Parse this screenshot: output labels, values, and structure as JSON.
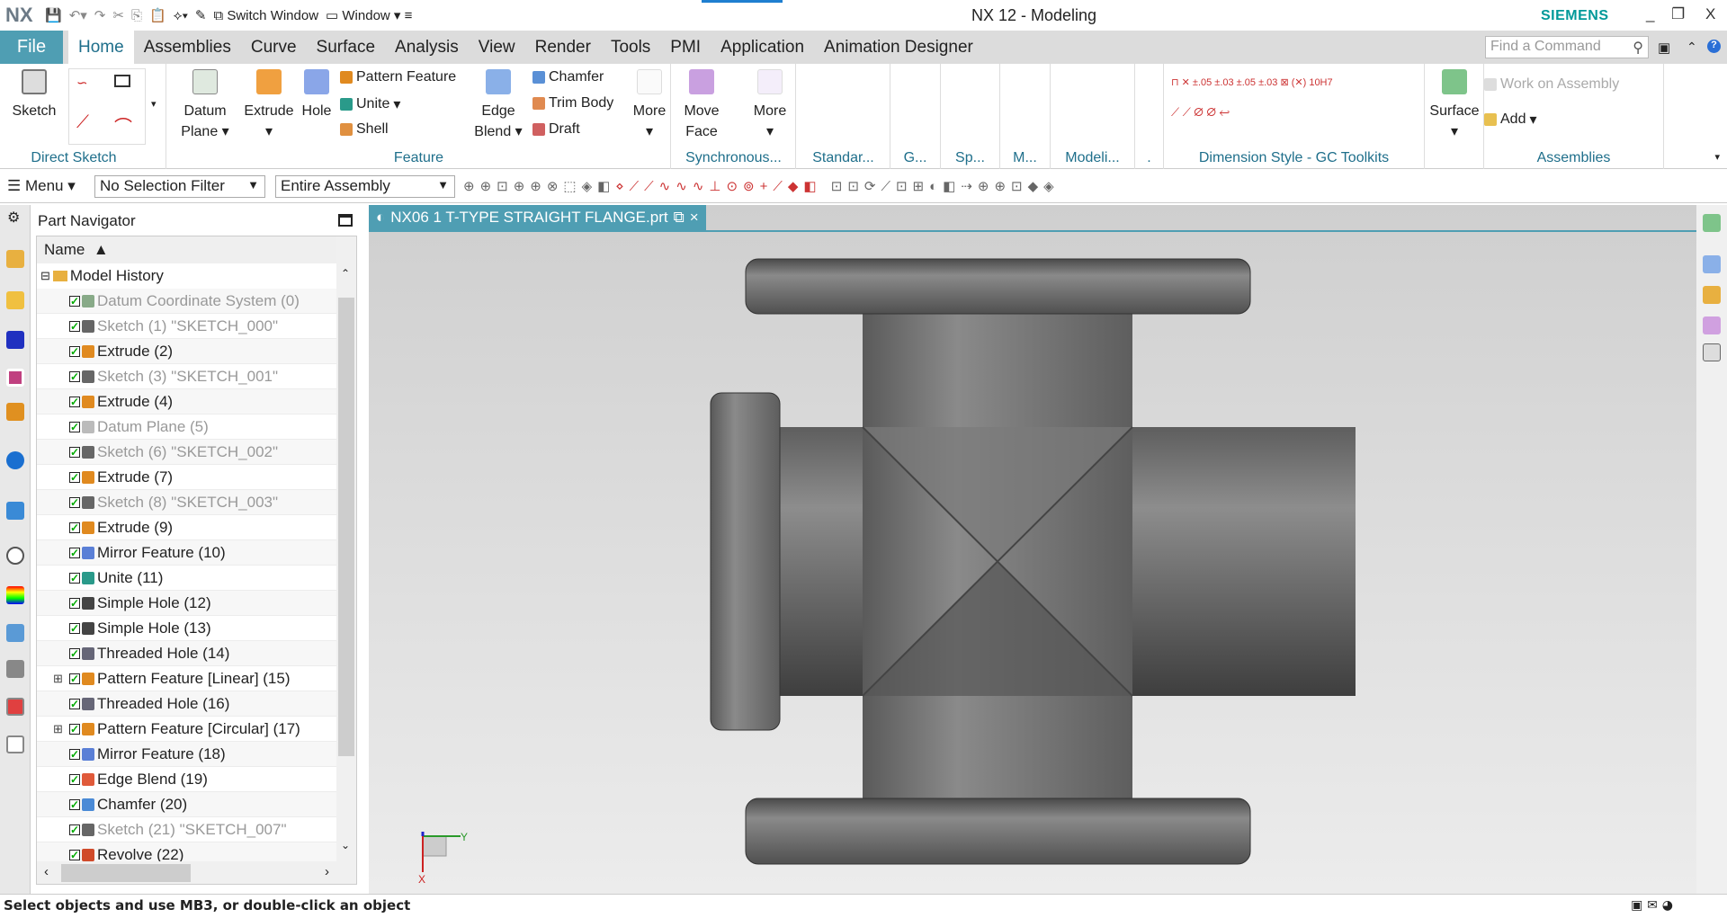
{
  "app": {
    "logo": "NX",
    "title": "NX 12 - Modeling",
    "brand": "SIEMENS",
    "minimize": "_",
    "restore": "❐",
    "close": "X"
  },
  "quick_access": {
    "switch_window": "Switch Window",
    "window": "Window"
  },
  "tabs": {
    "file": "File",
    "items": [
      "Home",
      "Assemblies",
      "Curve",
      "Surface",
      "Analysis",
      "View",
      "Render",
      "Tools",
      "PMI",
      "Application",
      "Animation Designer"
    ],
    "active": "Home"
  },
  "search": {
    "placeholder": "Find a Command"
  },
  "ribbon": {
    "direct_sketch": {
      "label": "Direct Sketch",
      "sketch": "Sketch"
    },
    "feature": {
      "label": "Feature",
      "datum_plane": "Datum Plane",
      "extrude": "Extrude",
      "hole": "Hole",
      "pattern_feature": "Pattern Feature",
      "unite": "Unite",
      "shell": "Shell",
      "edge_blend": "Edge Blend",
      "chamfer": "Chamfer",
      "trim_body": "Trim Body",
      "draft": "Draft",
      "more": "More"
    },
    "synchronous": {
      "label": "Synchronous...",
      "move_face": "Move Face",
      "more": "More"
    },
    "small_groups": [
      "Standar...",
      "G...",
      "Sp...",
      "M...",
      "Modeli...",
      "."
    ],
    "dimension_style": {
      "label": "Dimension Style - GC Toolkits"
    },
    "surface": {
      "label": "Surface"
    },
    "assemblies": {
      "label": "Assemblies",
      "work_on_assembly": "Work on Assembly",
      "add": "Add"
    }
  },
  "toolbar": {
    "menu": "Menu",
    "selection_filter": "No Selection Filter",
    "scope": "Entire Assembly"
  },
  "navigator": {
    "title": "Part Navigator",
    "column": "Name",
    "root": "Model History",
    "items": [
      {
        "label": "Datum Coordinate System (0)",
        "dim": true,
        "icon": "#8a8"
      },
      {
        "label": "Sketch (1) \"SKETCH_000\"",
        "dim": true,
        "icon": "#666"
      },
      {
        "label": "Extrude (2)",
        "dim": false,
        "icon": "#e08a20"
      },
      {
        "label": "Sketch (3) \"SKETCH_001\"",
        "dim": true,
        "icon": "#666"
      },
      {
        "label": "Extrude (4)",
        "dim": false,
        "icon": "#e08a20"
      },
      {
        "label": "Datum Plane (5)",
        "dim": true,
        "icon": "#bbb"
      },
      {
        "label": "Sketch (6) \"SKETCH_002\"",
        "dim": true,
        "icon": "#666"
      },
      {
        "label": "Extrude (7)",
        "dim": false,
        "icon": "#e08a20"
      },
      {
        "label": "Sketch (8) \"SKETCH_003\"",
        "dim": true,
        "icon": "#666"
      },
      {
        "label": "Extrude (9)",
        "dim": false,
        "icon": "#e08a20"
      },
      {
        "label": "Mirror Feature (10)",
        "dim": false,
        "icon": "#5a7fd6"
      },
      {
        "label": "Unite (11)",
        "dim": false,
        "icon": "#2a9a8a"
      },
      {
        "label": "Simple Hole (12)",
        "dim": false,
        "icon": "#444"
      },
      {
        "label": "Simple Hole (13)",
        "dim": false,
        "icon": "#444"
      },
      {
        "label": "Threaded Hole (14)",
        "dim": false,
        "icon": "#667"
      },
      {
        "label": "Pattern Feature [Linear] (15)",
        "dim": false,
        "icon": "#e08a20",
        "expandable": true
      },
      {
        "label": "Threaded Hole (16)",
        "dim": false,
        "icon": "#667"
      },
      {
        "label": "Pattern Feature [Circular] (17)",
        "dim": false,
        "icon": "#e08a20",
        "expandable": true
      },
      {
        "label": "Mirror Feature (18)",
        "dim": false,
        "icon": "#5a7fd6"
      },
      {
        "label": "Edge Blend (19)",
        "dim": false,
        "icon": "#e05a3a"
      },
      {
        "label": "Chamfer (20)",
        "dim": false,
        "icon": "#4a8ad6"
      },
      {
        "label": "Sketch (21) \"SKETCH_007\"",
        "dim": true,
        "icon": "#666"
      },
      {
        "label": "Revolve (22)",
        "dim": false,
        "icon": "#d04a2a"
      }
    ]
  },
  "viewport": {
    "tab": "NX06 1 T-TYPE STRAIGHT FLANGE.prt",
    "axis_y": "Y",
    "axis_x": "X"
  },
  "status": {
    "text": "Select objects and use MB3, or double-click an object"
  },
  "colors": {
    "accent": "#4f9eb3",
    "file_tab": "#4f9eb3",
    "ribbon_label": "#1f6f8b",
    "brand": "#009999",
    "model": "#6e6e6e"
  }
}
